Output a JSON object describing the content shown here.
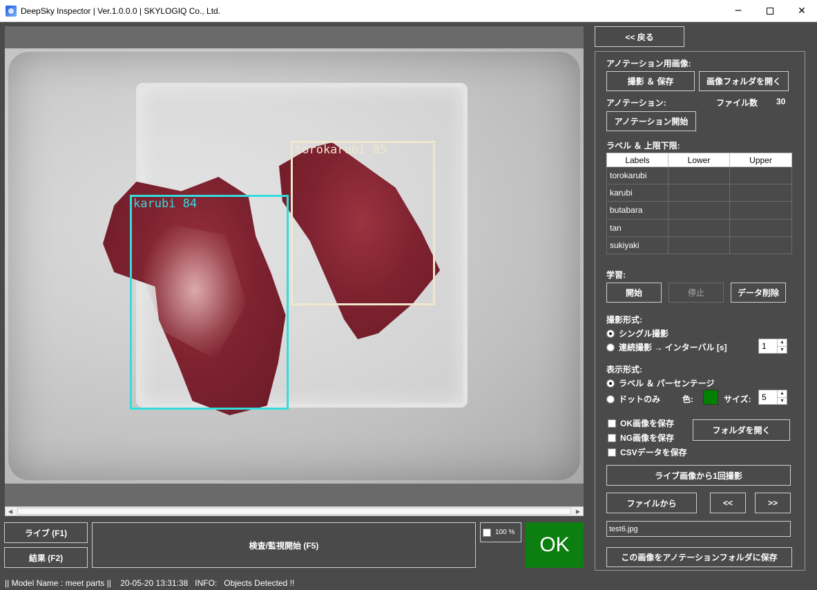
{
  "window": {
    "title": "DeepSky Inspector | Ver.1.0.0.0 | SKYLOGIQ Co., Ltd.",
    "minimize": "─",
    "maximize": "",
    "close": "✕"
  },
  "viewer": {
    "detections": [
      {
        "label": "karubi 84",
        "color": "#33dddd"
      },
      {
        "label": "torokarubi 85",
        "color": "#efe8cc"
      }
    ],
    "scroll_left": "◀",
    "scroll_right": "▶"
  },
  "bottom": {
    "live_button": "ライブ (F1)",
    "result_button": "結果 (F2)",
    "inspect_button": "検査/監視開始 (F5)",
    "zoom_label": "100 %",
    "status_result": "OK",
    "status_color": "#0d7f10"
  },
  "statusbar": {
    "text": "|| Model Name : meet parts ||    20-05-20 13:31:38   INFO:   Objects Detected !!"
  },
  "panel": {
    "back_button": "<< 戻る",
    "annotation_image_label": "アノテーション用画像:",
    "capture_save_button": "撮影 ＆ 保存",
    "open_image_folder_button": "画像フォルダを開く",
    "annotation_label": "アノテーション:",
    "file_count_label": "ファイル数",
    "file_count_value": "30",
    "start_annotation_button": "アノテーション開始",
    "label_limits_label": "ラベル ＆ 上限下限:",
    "table": {
      "headers": [
        "Labels",
        "Lower",
        "Upper"
      ],
      "rows": [
        [
          "torokarubi",
          "",
          ""
        ],
        [
          "karubi",
          "",
          ""
        ],
        [
          "butabara",
          "",
          ""
        ],
        [
          "tan",
          "",
          ""
        ],
        [
          "sukiyaki",
          "",
          ""
        ]
      ]
    },
    "training_label": "学習:",
    "start_button": "開始",
    "stop_button": "停止",
    "delete_data_button": "データ削除",
    "capture_mode_label": "撮影形式:",
    "single_capture": "シングル撮影",
    "continuous_capture": "連続撮影 → インターバル [s]",
    "interval_value": "1",
    "display_mode_label": "表示形式:",
    "label_percent": "ラベル ＆ パーセンテージ",
    "dot_only": "ドットのみ",
    "color_label": "色:",
    "dot_color": "#008000",
    "size_label": "サイズ:",
    "size_value": "5",
    "save_ok": "OK画像を保存",
    "save_ng": "NG画像を保存",
    "save_csv": "CSVデータを保存",
    "open_folder_button": "フォルダを開く",
    "capture_once_button": "ライブ画像から1回撮影",
    "from_file_button": "ファイルから",
    "prev_button": "<<",
    "next_button": ">>",
    "filename": "test6.jpg",
    "save_to_annotation_button": "この画像をアノテーションフォルダに保存"
  }
}
